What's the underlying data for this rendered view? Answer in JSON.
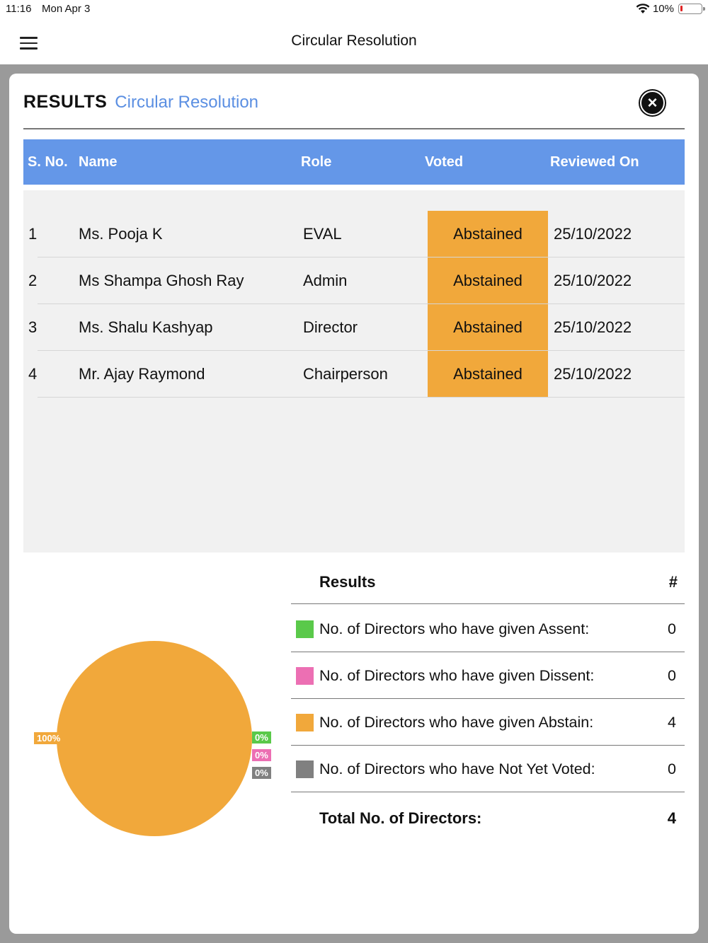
{
  "status_bar": {
    "time": "11:16",
    "date": "Mon Apr 3",
    "battery_text": "10%",
    "battery_level": 0.1
  },
  "nav": {
    "title": "Circular Resolution",
    "menu_icon": "hamburger-icon"
  },
  "modal": {
    "title_bold": "RESULTS",
    "title_sub": "Circular Resolution",
    "close_icon": "close-circle-icon"
  },
  "table": {
    "headers": {
      "sno": "S. No.",
      "name": "Name",
      "role": "Role",
      "voted": "Voted",
      "reviewed": "Reviewed On"
    },
    "rows": [
      {
        "sno": "1",
        "name": "Ms. Pooja K",
        "role": "EVAL",
        "voted": "Abstained",
        "reviewed": "25/10/2022"
      },
      {
        "sno": "2",
        "name": "Ms Shampa Ghosh Ray",
        "role": "Admin",
        "voted": "Abstained",
        "reviewed": "25/10/2022"
      },
      {
        "sno": "3",
        "name": "Ms. Shalu Kashyap",
        "role": "Director",
        "voted": "Abstained",
        "reviewed": "25/10/2022"
      },
      {
        "sno": "4",
        "name": "Mr. Ajay Raymond",
        "role": "Chairperson",
        "voted": "Abstained",
        "reviewed": "25/10/2022"
      }
    ]
  },
  "results": {
    "header_label": "Results",
    "header_count": "#",
    "items": [
      {
        "label": "No. of Directors who have given Assent:",
        "count": "0",
        "color": "#5ac94a"
      },
      {
        "label": "No. of Directors who have given Dissent:",
        "count": "0",
        "color": "#ec6fb3"
      },
      {
        "label": "No. of Directors who have given Abstain:",
        "count": "4",
        "color": "#f1a83b"
      },
      {
        "label": "No. of Directors who have Not Yet Voted:",
        "count": "0",
        "color": "#808080"
      }
    ],
    "total_label": "Total No. of Directors:",
    "total_count": "4"
  },
  "chart_data": {
    "type": "pie",
    "slices": [
      {
        "name": "Assent",
        "value": 0,
        "label": "0%",
        "color": "#5ac94a"
      },
      {
        "name": "Dissent",
        "value": 0,
        "label": "0%",
        "color": "#ec6fb3"
      },
      {
        "name": "Abstain",
        "value": 100,
        "label": "100%",
        "color": "#f1a83b"
      },
      {
        "name": "Not Yet Voted",
        "value": 0,
        "label": "0%",
        "color": "#808080"
      }
    ]
  }
}
